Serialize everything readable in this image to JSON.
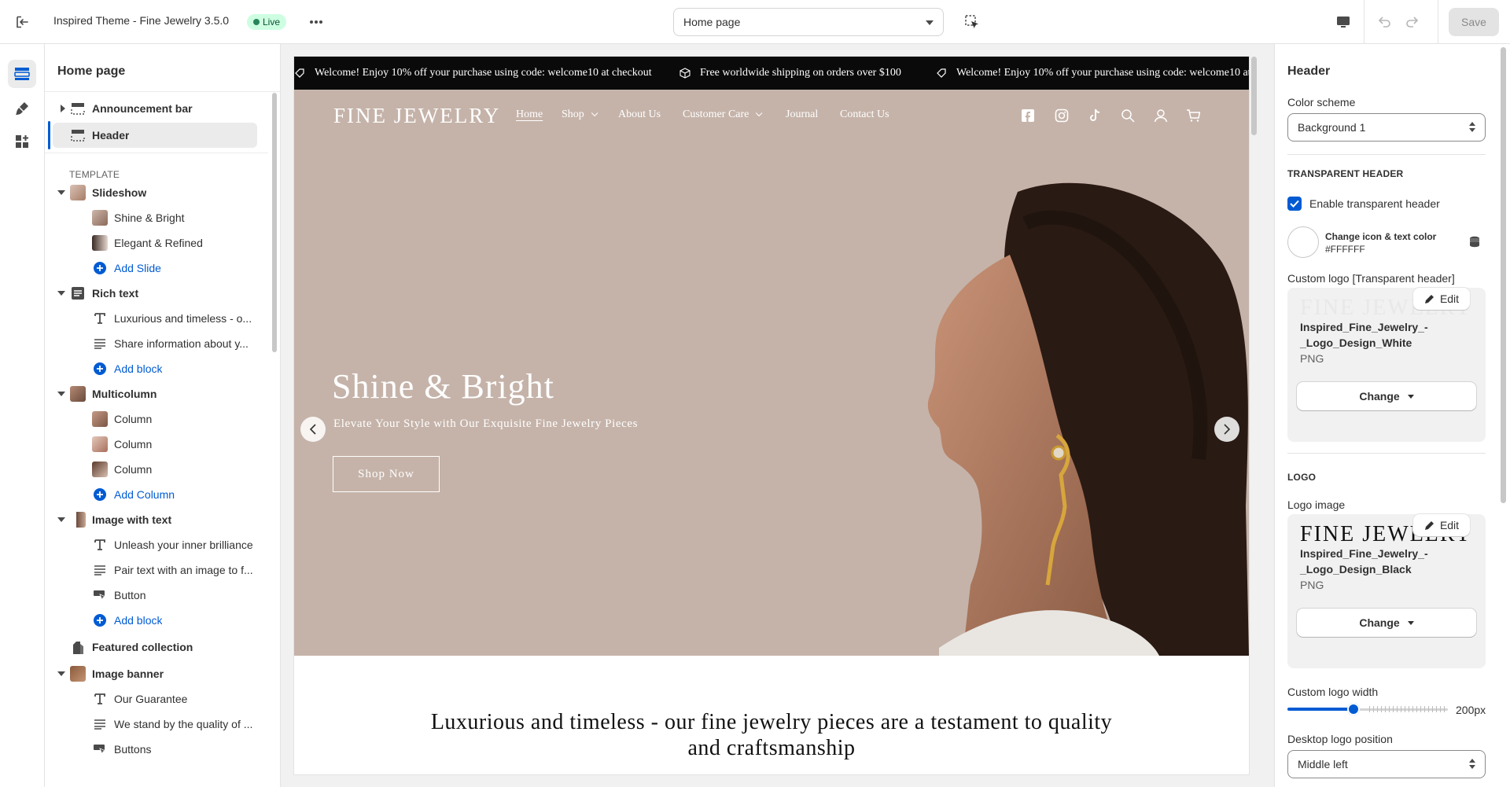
{
  "topbar": {
    "title": "Inspired Theme - Fine Jewelry 3.5.0",
    "status": "Live",
    "page_select": "Home page",
    "save_label": "Save"
  },
  "sidebar": {
    "title": "Home page",
    "template_label": "TEMPLATE",
    "header_items": [
      {
        "label": "Announcement bar"
      },
      {
        "label": "Header"
      }
    ],
    "items": [
      {
        "label": "Slideshow"
      },
      {
        "label": "Shine & Bright"
      },
      {
        "label": "Elegant & Refined"
      },
      {
        "label": "Add Slide"
      },
      {
        "label": "Rich text"
      },
      {
        "label": "Luxurious and timeless - o..."
      },
      {
        "label": "Share information about y..."
      },
      {
        "label": "Add block"
      },
      {
        "label": "Multicolumn"
      },
      {
        "label": "Column"
      },
      {
        "label": "Column"
      },
      {
        "label": "Column"
      },
      {
        "label": "Add Column"
      },
      {
        "label": "Image with text"
      },
      {
        "label": "Unleash your inner brilliance"
      },
      {
        "label": "Pair text with an image to f..."
      },
      {
        "label": "Button"
      },
      {
        "label": "Add block"
      },
      {
        "label": "Featured collection"
      },
      {
        "label": "Image banner"
      },
      {
        "label": "Our Guarantee"
      },
      {
        "label": "We stand by the quality of ..."
      },
      {
        "label": "Buttons"
      }
    ]
  },
  "preview": {
    "announcements": [
      "Welcome! Enjoy 10% off your purchase using code: welcome10 at checkout",
      "Free worldwide shipping on orders over $100",
      "Welcome! Enjoy 10% off your purchase using code: welcome10 at checkout"
    ],
    "logo": "FINE JEWELRY",
    "nav": [
      "Home",
      "Shop",
      "About Us",
      "Customer Care",
      "Journal",
      "Contact Us"
    ],
    "hero_title": "Shine & Bright",
    "hero_subtitle": "Elevate Your Style with Our Exquisite Fine Jewelry Pieces",
    "hero_button": "Shop Now",
    "rich_text_heading": "Luxurious and timeless - our fine jewelry pieces are a testament to quality and craftsmanship"
  },
  "settings": {
    "title": "Header",
    "color_scheme_label": "Color scheme",
    "color_scheme_value": "Background 1",
    "transparent_header_heading": "TRANSPARENT HEADER",
    "enable_transparent_label": "Enable transparent header",
    "enable_transparent_checked": true,
    "icon_text_color_label": "Change icon & text color",
    "icon_text_color_value": "#FFFFFF",
    "custom_logo_label": "Custom logo [Transparent header]",
    "transparent_logo": {
      "preview_text": "FINE JEWELRY",
      "file_name": "Inspired_Fine_Jewelry_-_Logo_Design_White",
      "file_type": "PNG"
    },
    "edit_label": "Edit",
    "change_label": "Change",
    "logo_heading": "LOGO",
    "logo_image_label": "Logo image",
    "logo": {
      "preview_text": "FINE JEWELRY",
      "file_name": "Inspired_Fine_Jewelry_-_Logo_Design_Black",
      "file_type": "PNG"
    },
    "custom_logo_width_label": "Custom logo width",
    "custom_logo_width_value": "200px",
    "custom_logo_width_fraction": 0.41,
    "desktop_logo_position_label": "Desktop logo position",
    "desktop_logo_position_value": "Middle left"
  },
  "colors": {
    "accent": "#005bd3",
    "hero_bg": "#c5b3a9",
    "announcement_bg": "#0a0a0a",
    "live_badge": "#cdfee1"
  }
}
